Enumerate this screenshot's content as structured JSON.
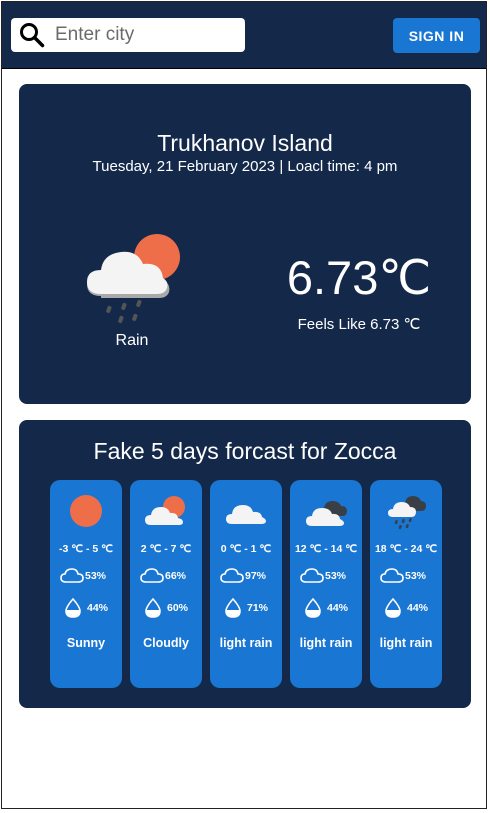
{
  "search": {
    "placeholder": "Enter city"
  },
  "header": {
    "signin_label": "SIGN IN"
  },
  "current": {
    "city": "Trukhanov Island",
    "datetime": "Tuesday, 21 February 2023 | Loacl time: 4 pm",
    "condition": "Rain",
    "temperature": "6.73℃",
    "feels_like": "Feels Like 6.73 ℃",
    "icon": "sun-cloud-rain-icon"
  },
  "forecast": {
    "title": "Fake 5 days forcast for Zocca",
    "days": [
      {
        "temp_range": "-3 ℃ - 5 ℃",
        "clouds": "53%",
        "humidity": "44%",
        "description": "Sunny",
        "icon": "sun-icon"
      },
      {
        "temp_range": "2 ℃ - 7 ℃",
        "clouds": "66%",
        "humidity": "60%",
        "description": "Cloudly",
        "icon": "sun-cloud-icon"
      },
      {
        "temp_range": "0 ℃ - 1 ℃",
        "clouds": "97%",
        "humidity": "71%",
        "description": "light rain",
        "icon": "cloud-icon"
      },
      {
        "temp_range": "12 ℃ - 14 ℃",
        "clouds": "53%",
        "humidity": "44%",
        "description": "light rain",
        "icon": "dark-cloud-icon"
      },
      {
        "temp_range": "18 ℃ - 24 ℃",
        "clouds": "53%",
        "humidity": "44%",
        "description": "light rain",
        "icon": "dark-cloud-rain-icon"
      }
    ]
  },
  "colors": {
    "navy": "#14294a",
    "accent_blue": "#1976d2",
    "sun": "#ee6e4a",
    "cloud": "#f4f4f4",
    "dark_cloud": "#3a3f47"
  }
}
